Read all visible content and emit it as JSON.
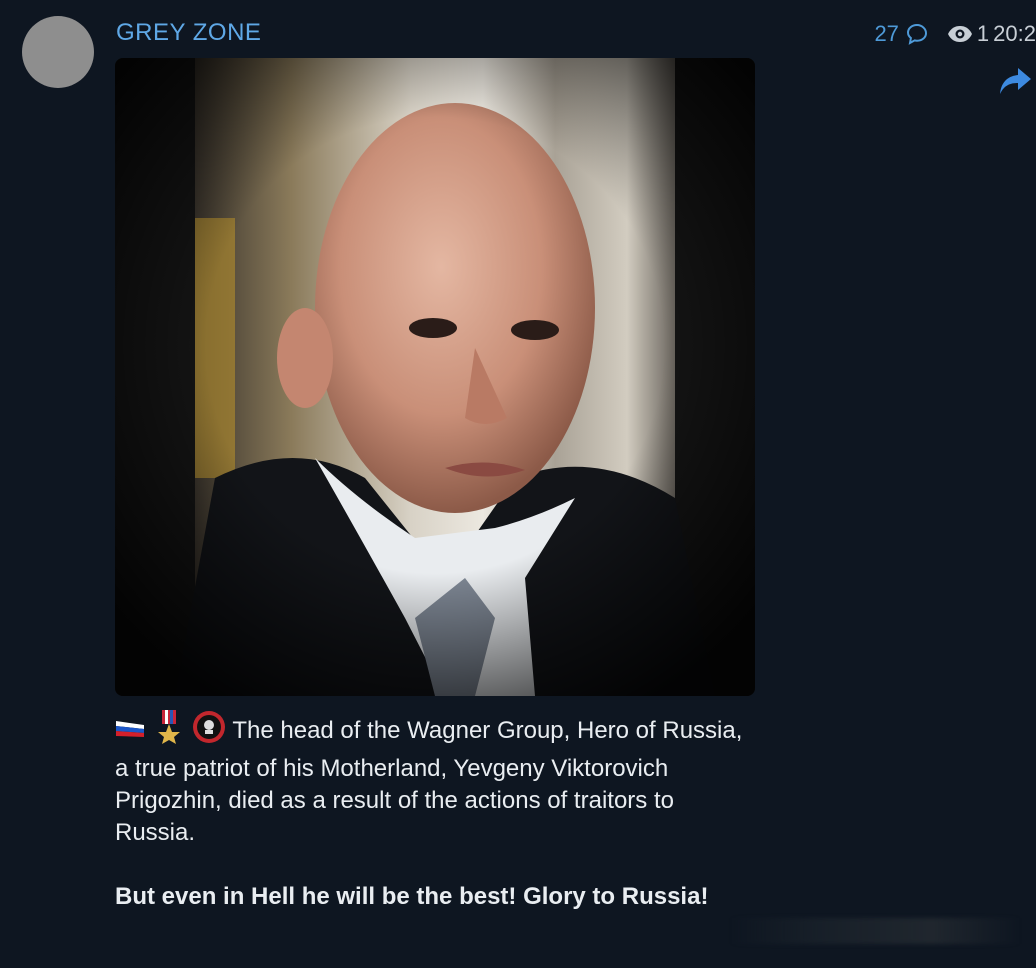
{
  "post": {
    "channel_name": "GREY ZONE",
    "comments_count": "27",
    "views": "1",
    "time": "20:2",
    "caption_line1": "The head of the Wagner Group, Hero of Russia, a true patriot of his Motherland, Yevgeny Viktorovich Prigozhin, died as a result of the actions of traitors to Russia.",
    "caption_line2": "But even in Hell he will be the best! Glory to Russia!"
  },
  "icons": {
    "comment": "comment-bubble-icon",
    "views": "eye-icon",
    "share": "share-arrow-icon",
    "emoji_flag": "russian-flag-icon",
    "emoji_medal": "hero-medal-icon",
    "emoji_badge": "wagner-badge-icon"
  },
  "colors": {
    "background": "#0e1621",
    "accent": "#5fa8e6",
    "text": "#e9edf1"
  }
}
